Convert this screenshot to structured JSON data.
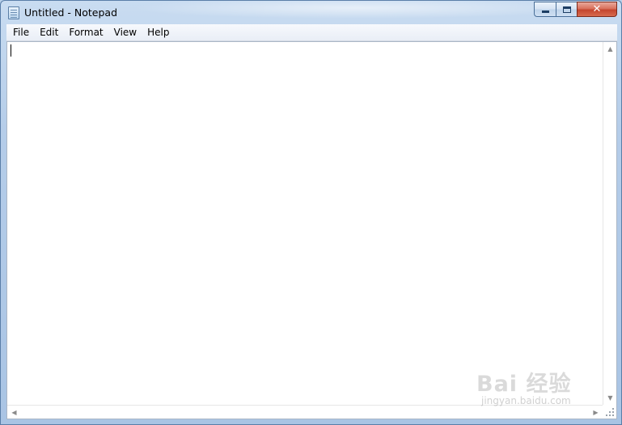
{
  "window": {
    "title": "Untitled - Notepad",
    "app_icon": "notepad-icon"
  },
  "caption_buttons": {
    "minimize_icon": "minimize-icon",
    "maximize_icon": "maximize-icon",
    "close_icon": "close-icon",
    "close_glyph": "✕"
  },
  "menu": {
    "items": [
      "File",
      "Edit",
      "Format",
      "View",
      "Help"
    ]
  },
  "editor": {
    "content": ""
  },
  "scrollbars": {
    "up_glyph": "▲",
    "down_glyph": "▼",
    "left_glyph": "◀",
    "right_glyph": "▶"
  },
  "watermark": {
    "brand": "Bai 经验",
    "url": "jingyan.baidu.com"
  },
  "colors": {
    "close_button": "#c4452e",
    "frame": "#b5cde9"
  }
}
